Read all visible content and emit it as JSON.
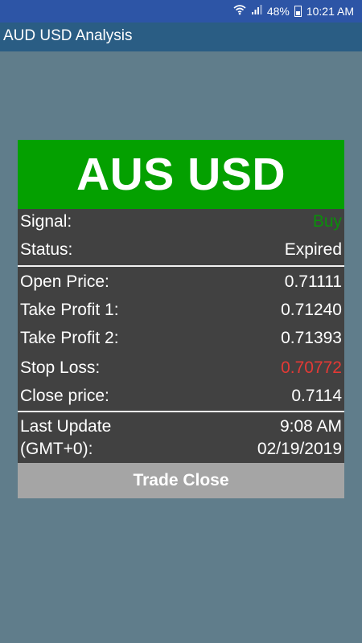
{
  "status_bar": {
    "battery_percent": "48%",
    "time": "10:21 AM"
  },
  "app_bar": {
    "title": "AUD USD Analysis"
  },
  "card": {
    "pair_title": "AUS USD",
    "signal": {
      "label": "Signal:",
      "value": "Buy",
      "color": "#0a8f0a"
    },
    "status": {
      "label": "Status:",
      "value": "Expired"
    },
    "open_price": {
      "label": "Open Price:",
      "value": "0.71111"
    },
    "take_profit_1": {
      "label": "Take Profit 1:",
      "value": "0.71240"
    },
    "take_profit_2": {
      "label": "Take Profit 2:",
      "value": "0.71393"
    },
    "stop_loss": {
      "label": "Stop Loss:",
      "value": "0.70772",
      "color": "#e53935"
    },
    "close_price": {
      "label": "Close price:",
      "value": "0.7114"
    },
    "last_update": {
      "label_line1": "Last Update",
      "label_line2": "(GMT+0):",
      "time": "9:08 AM",
      "date": "02/19/2019"
    },
    "trade_button": {
      "label": "Trade Close"
    }
  },
  "colors": {
    "background": "#607d8b",
    "header_green": "#04a000",
    "card_bg": "#414141",
    "button_grey": "#a5a5a5"
  }
}
